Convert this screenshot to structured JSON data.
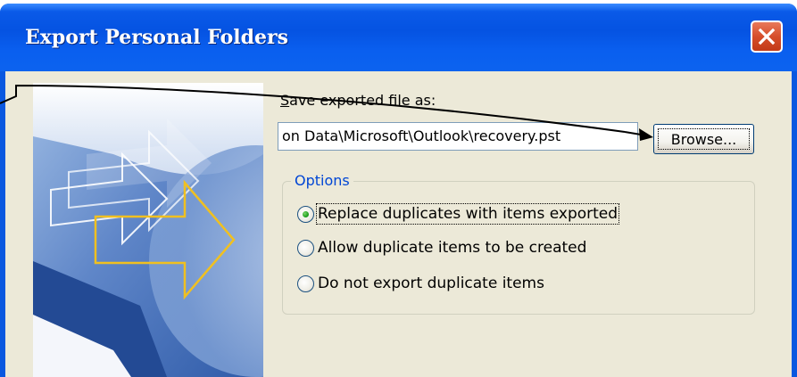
{
  "window": {
    "title": "Export Personal Folders",
    "title_bar_color": "#0a58e0",
    "close_button_color": "#d64e2a",
    "close_icon": "close-icon"
  },
  "save": {
    "label_underlined": "S",
    "label_rest": "ave exported file as:",
    "path_value": "on Data\\Microsoft\\Outlook\\recovery.pst",
    "browse_label": "Browse..."
  },
  "options": {
    "legend": "Options",
    "legend_color": "#0046d5",
    "items": [
      {
        "label": "Replace duplicates with items exported",
        "checked": true
      },
      {
        "label": "Allow duplicate items to be created",
        "checked": false
      },
      {
        "label": "Do not export duplicate items",
        "checked": false
      }
    ]
  },
  "wizard_graphic": {
    "icon": "wizard-arrows-graphic",
    "accent_color": "#f0c020"
  },
  "annotation": {
    "icon": "annotation-arrow",
    "color": "#000000"
  }
}
